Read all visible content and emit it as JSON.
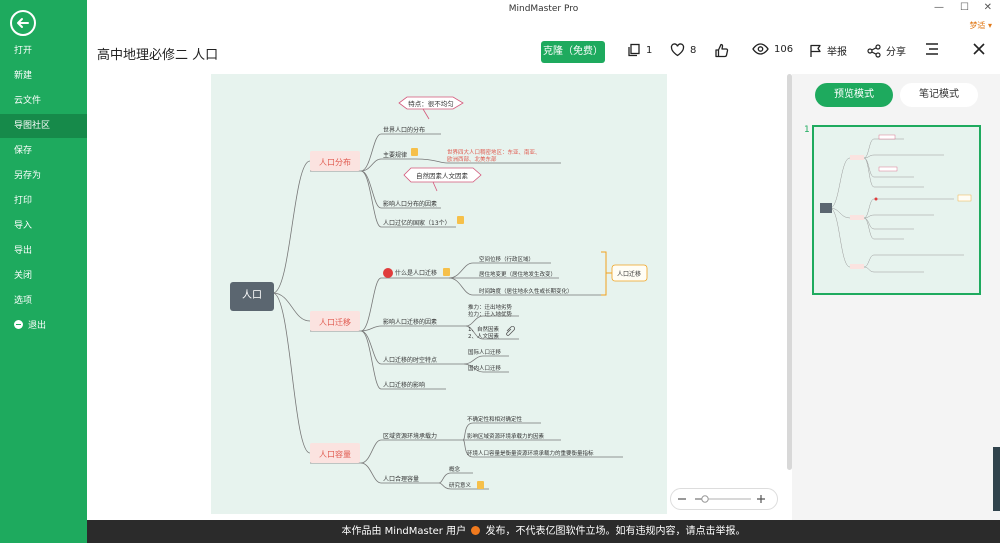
{
  "window": {
    "title": "MindMaster Pro",
    "user": "梦适 ▾"
  },
  "sidebar": {
    "items": [
      {
        "label": "打开"
      },
      {
        "label": "新建"
      },
      {
        "label": "云文件"
      },
      {
        "label": "导图社区"
      },
      {
        "label": "保存"
      },
      {
        "label": "另存为"
      },
      {
        "label": "打印"
      },
      {
        "label": "导入"
      },
      {
        "label": "导出"
      },
      {
        "label": "关闭"
      },
      {
        "label": "选项"
      },
      {
        "label": "退出"
      }
    ],
    "active_index": 3
  },
  "toolbar": {
    "doc_title": "高中地理必修二 人口",
    "clone_label": "克隆（免费）",
    "pages_count": "1",
    "likes_count": "8",
    "views_count": "106",
    "report_label": "举报",
    "share_label": "分享"
  },
  "panel": {
    "preview_label": "预览模式",
    "notes_label": "笔记模式",
    "page_number": "1"
  },
  "footer": {
    "notice_part1": "本作品由 MindMaster 用户",
    "notice_part2": "发布，不代表亿图软件立场。如有违规内容，请点击举报。"
  },
  "mindmap": {
    "root": "人口",
    "branches": [
      {
        "label": "人口分布",
        "children": [
          "世界人口的分布",
          "主要规律",
          "影响人口分布的因素",
          "人口过亿的国家（13个）"
        ]
      },
      {
        "label": "人口迁移",
        "children": [
          "什么是人口迁移",
          "影响人口迁移的因素",
          "人口迁移的时空特点",
          "人口迁移的影响"
        ]
      },
      {
        "label": "人口容量",
        "children": [
          "区域资源环境承载力",
          "人口合理容量"
        ]
      }
    ],
    "callouts": {
      "distribution": "特点：很不均匀",
      "factors": "自然因素人文因素",
      "migration_summary": "人口迁移"
    },
    "rule_text": [
      "世界四大人口稠密地区：东亚、南亚、",
      "欧洲西部、北美东部"
    ],
    "what_children": [
      "空间位移（行政区域）",
      "居住地变更（居住地发生改变）",
      "时间跨度（居住地永久性或长期变化）"
    ],
    "factor_children": [
      "推力：迁出地劣势",
      "拉力：迁入地优势",
      "1、自然因素",
      "2、人文因素"
    ],
    "spatiotemporal_children": [
      "国际人口迁移",
      "国内人口迁移"
    ],
    "carrying_children": [
      "不确定性和相对确定性",
      "影响区域资源环境承载力的因素",
      "环境人口容量是衡量资源环境承载力的重要衡量指标"
    ],
    "reasonable_children": [
      "概念",
      "研究意义"
    ]
  },
  "colors": {
    "accent": "#1eaa5e",
    "canvas": "#e7f3ee",
    "branch_fill": "#fbe3e0",
    "branch_text": "#e05a4f",
    "callout_stroke": "#d4577a",
    "orange": "#f0a21e"
  }
}
